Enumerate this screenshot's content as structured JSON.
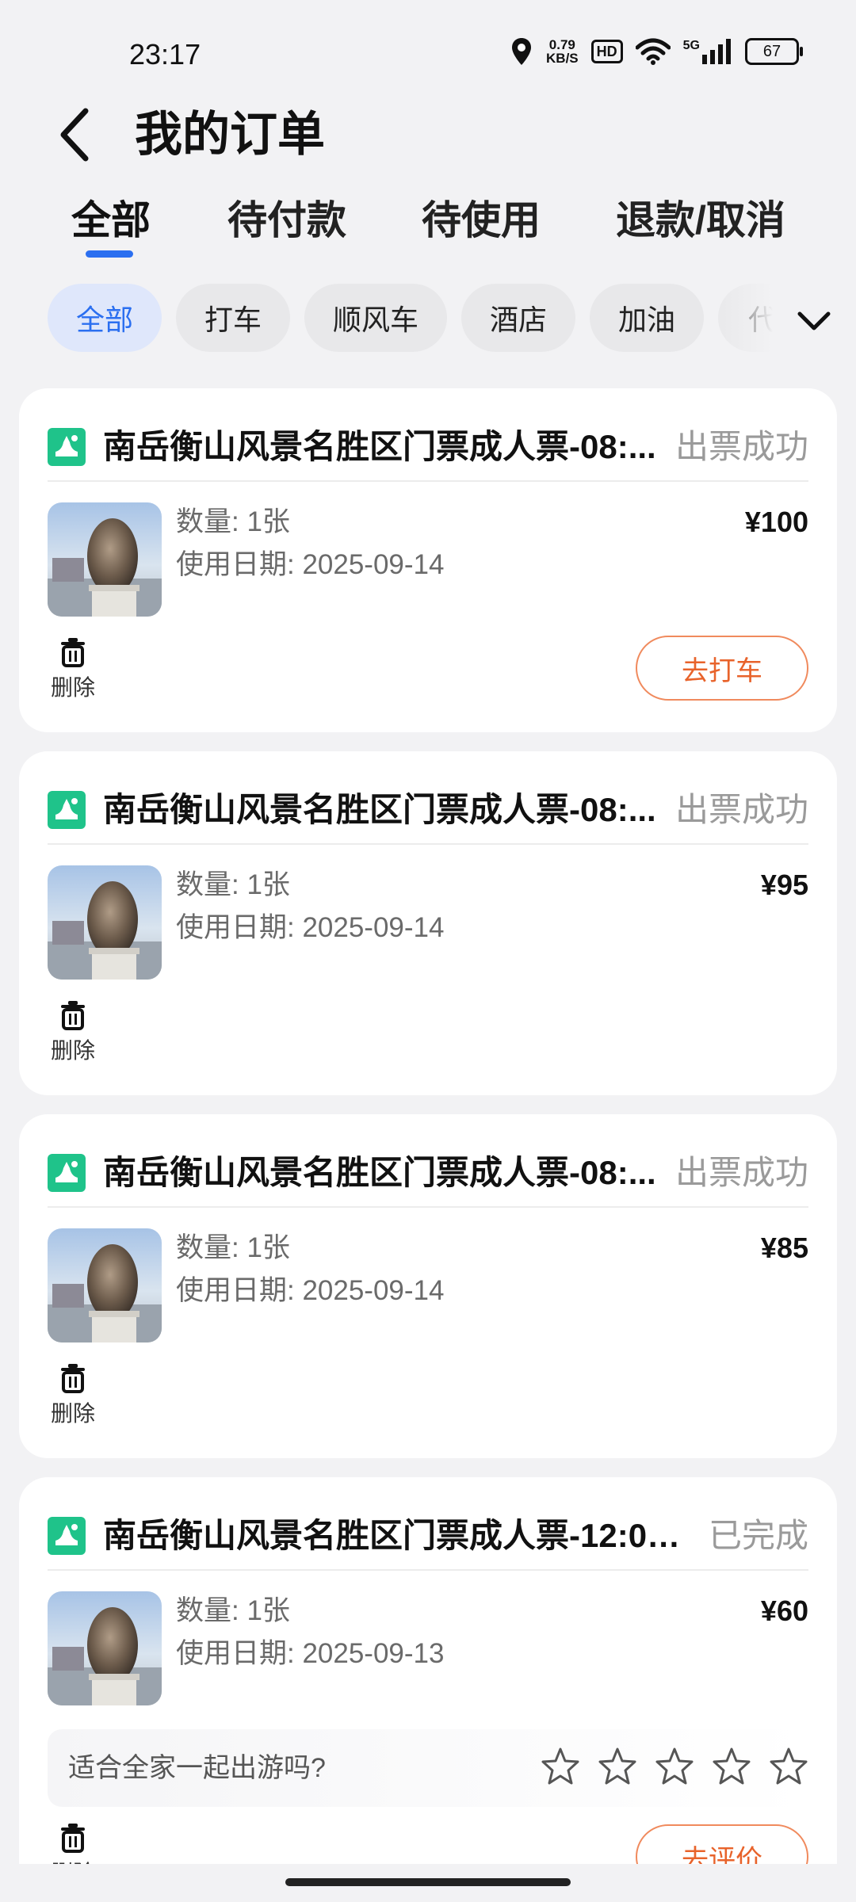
{
  "status_bar": {
    "time": "23:17",
    "net_speed_value": "0.79",
    "net_speed_unit": "KB/S",
    "hd": "HD",
    "signal_type": "5G",
    "battery": "67"
  },
  "header": {
    "title": "我的订单",
    "back_icon": "chevron-left-icon"
  },
  "tabs": [
    {
      "label": "全部",
      "active": true
    },
    {
      "label": "待付款"
    },
    {
      "label": "待使用"
    },
    {
      "label": "退款/取消"
    }
  ],
  "chips": [
    {
      "label": "全部",
      "active": true
    },
    {
      "label": "打车"
    },
    {
      "label": "顺风车"
    },
    {
      "label": "酒店"
    },
    {
      "label": "加油"
    },
    {
      "label": "代"
    }
  ],
  "colors": {
    "accent": "#2b6ff0",
    "action": "#e8632b",
    "ticket_icon": "#1fc38a",
    "status_text": "#9a9a9a"
  },
  "orders": [
    {
      "title": "南岳衡山风景名胜区门票成人票-08:...",
      "status": "出票成功",
      "qty": "数量: 1张",
      "date": "使用日期: 2025-09-14",
      "price": "¥100",
      "delete_label": "删除",
      "action": "去打车"
    },
    {
      "title": "南岳衡山风景名胜区门票成人票-08:...",
      "status": "出票成功",
      "qty": "数量: 1张",
      "date": "使用日期: 2025-09-14",
      "price": "¥95",
      "delete_label": "删除"
    },
    {
      "title": "南岳衡山风景名胜区门票成人票-08:...",
      "status": "出票成功",
      "qty": "数量: 1张",
      "date": "使用日期: 2025-09-14",
      "price": "¥85",
      "delete_label": "删除"
    },
    {
      "title": "南岳衡山风景名胜区门票成人票-12:00-...",
      "status": "已完成",
      "qty": "数量: 1张",
      "date": "使用日期: 2025-09-13",
      "price": "¥60",
      "rating_question": "适合全家一起出游吗?",
      "stars": 5,
      "delete_label": "删除",
      "action": "去评价"
    }
  ]
}
